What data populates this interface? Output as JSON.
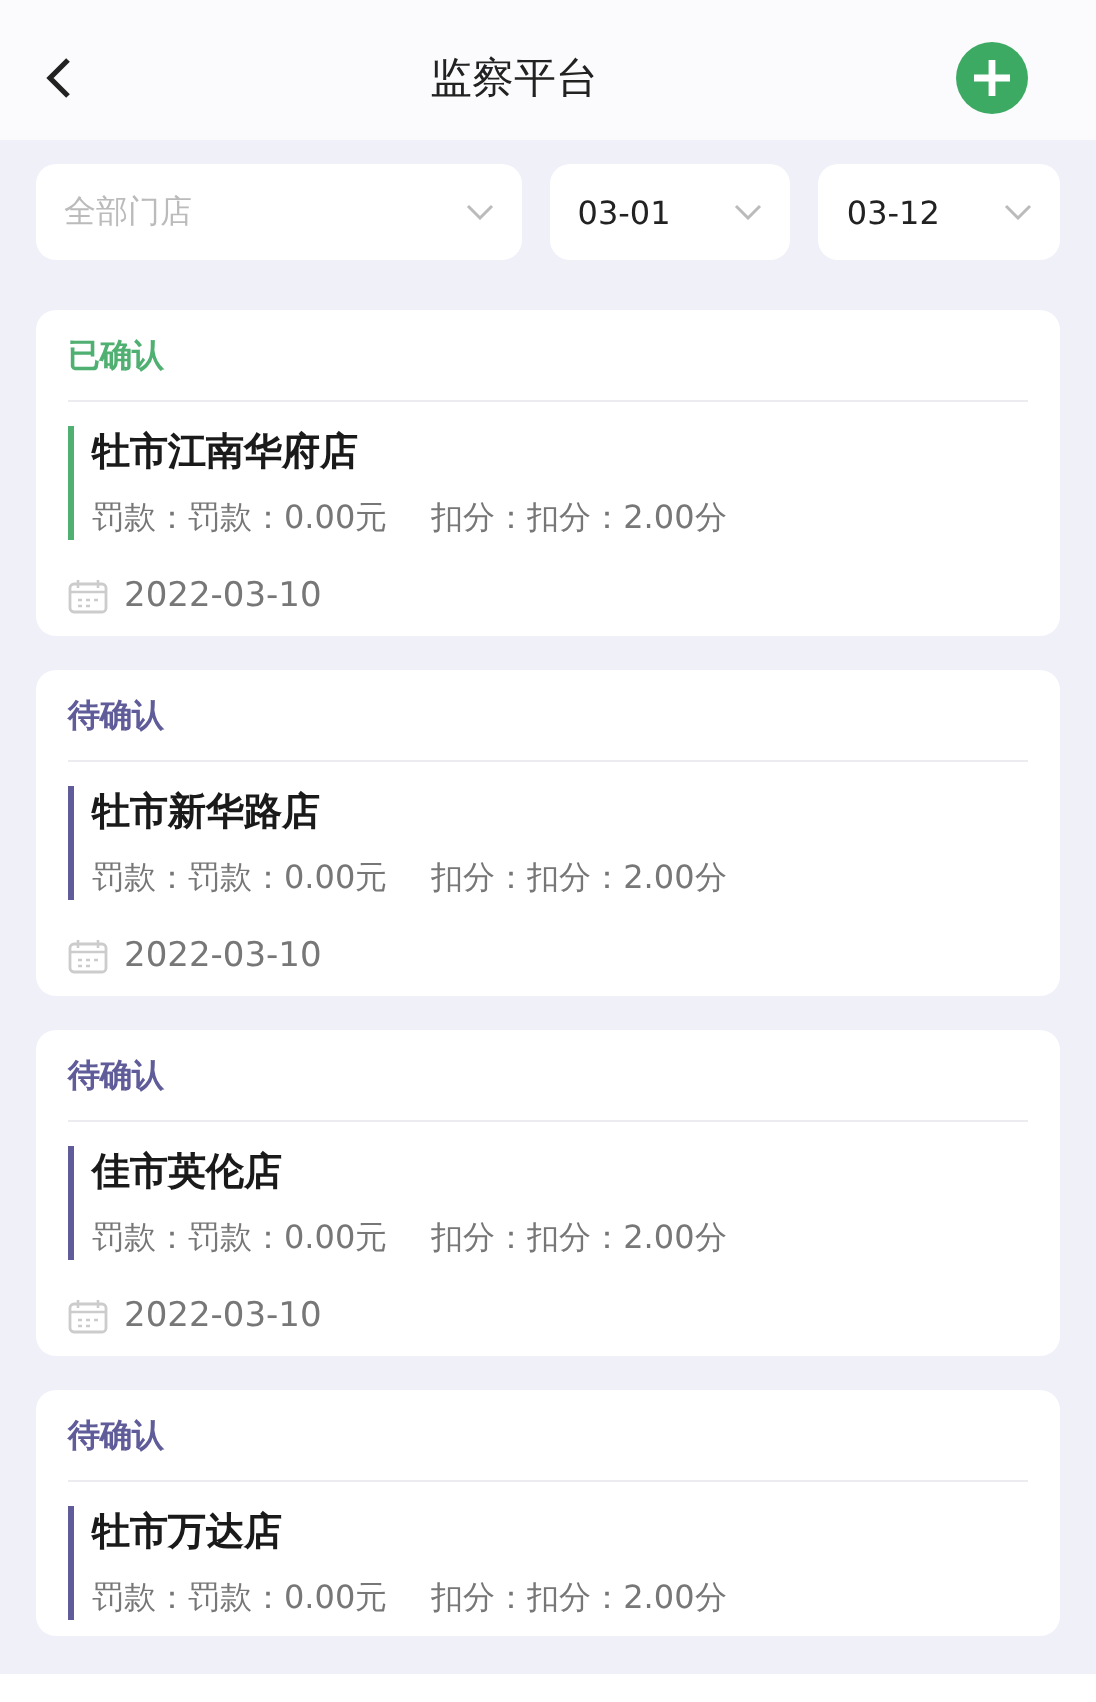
{
  "header": {
    "title": "监察平台"
  },
  "filters": {
    "store": {
      "placeholder": "全部门店"
    },
    "start_date": {
      "value": "03-01"
    },
    "end_date": {
      "value": "03-12"
    }
  },
  "records": [
    {
      "status": "已确认",
      "confirmed": true,
      "store": "牡市江南华府店",
      "fine": "罚款：罚款：0.00元",
      "points": "扣分：扣分：2.00分",
      "date": "2022-03-10"
    },
    {
      "status": "待确认",
      "confirmed": false,
      "store": "牡市新华路店",
      "fine": "罚款：罚款：0.00元",
      "points": "扣分：扣分：2.00分",
      "date": "2022-03-10"
    },
    {
      "status": "待确认",
      "confirmed": false,
      "store": "佳市英伦店",
      "fine": "罚款：罚款：0.00元",
      "points": "扣分：扣分：2.00分",
      "date": "2022-03-10"
    },
    {
      "status": "待确认",
      "confirmed": false,
      "store": "牡市万达店",
      "fine": "罚款：罚款：0.00元",
      "points": "扣分：扣分：2.00分"
    }
  ]
}
